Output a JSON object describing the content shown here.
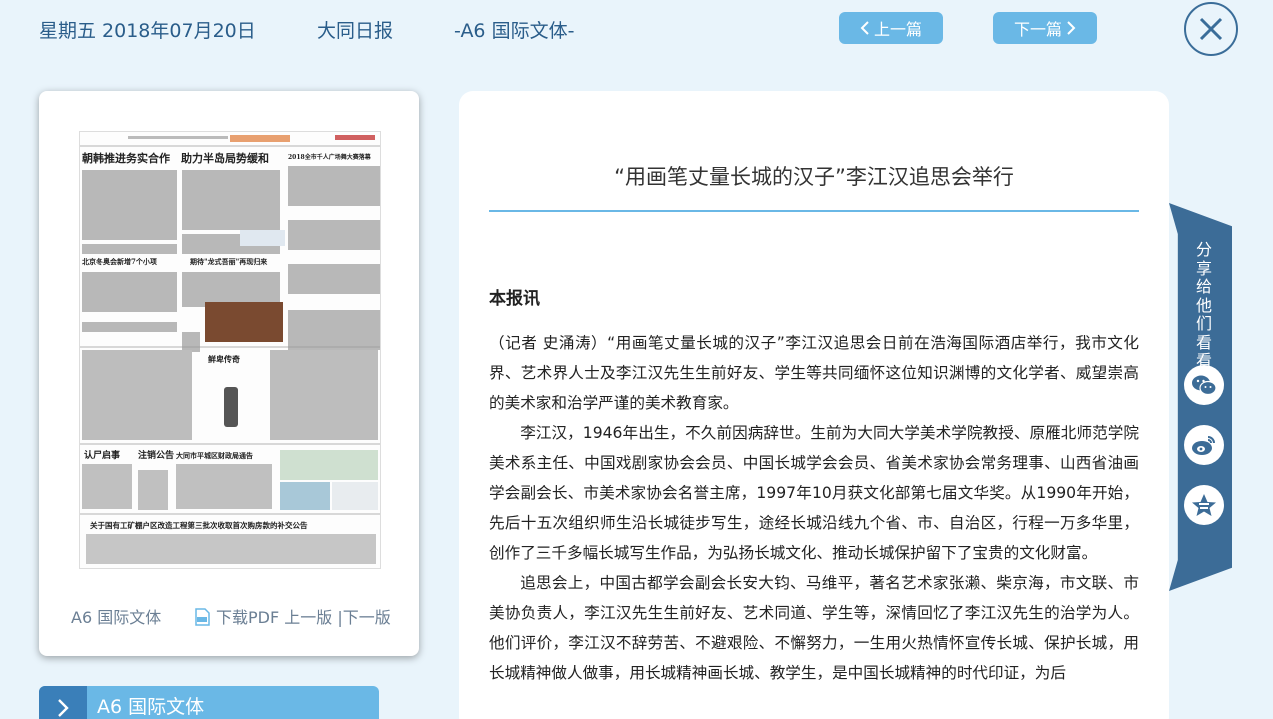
{
  "header": {
    "date": "星期五 2018年07月20日",
    "paper": "大同日报",
    "page": "-A6 国际文体-",
    "prev_label": "上一篇",
    "next_label": "下一篇"
  },
  "left_card": {
    "section": "A6 国际文体",
    "download": "下载PDF",
    "prev_page": "上一版",
    "separator": "|",
    "next_page": "下一版"
  },
  "section_bar": {
    "label": "A6 国际文体"
  },
  "article": {
    "title": "“用画笔丈量长城的汉子”李江汉追思会举行",
    "subtitle": "本报讯",
    "paragraphs": [
      "（记者 史涌涛）“用画笔丈量长城的汉子”李江汉追思会日前在浩海国际酒店举行，我市文化界、艺术界人士及李江汉先生生前好友、学生等共同缅怀这位知识渊博的文化学者、威望崇高的美术家和治学严谨的美术教育家。",
      "李江汉，1946年出生，不久前因病辞世。生前为大同大学美术学院教授、原雁北师范学院美术系主任、中国戏剧家协会会员、中国长城学会会员、省美术家协会常务理事、山西省油画学会副会长、市美术家协会名誉主席，1997年10月获文化部第七届文华奖。从1990年开始，先后十五次组织师生沿长城徒步写生，途经长城沿线九个省、市、自治区，行程一万多华里，创作了三千多幅长城写生作品，为弘扬长城文化、推动长城保护留下了宝贵的文化财富。",
      "追思会上，中国古都学会副会长安大钧、马维平，著名艺术家张濑、柴京海，市文联、市美协负责人，李江汉先生生前好友、艺术同道、学生等，深情回忆了李江汉先生的治学为人。他们评价，李江汉不辞劳苦、不避艰险、不懈努力，一生用火热情怀宣传长城、保护长城，用长城精神做人做事，用长城精神画长城、教学生，是中国长城精神的时代印证，为后"
    ]
  },
  "share": {
    "label": "分享给他们看看"
  },
  "thumbnail": {
    "headline1": "朝韩推进务实合作　助力半岛局势缓和",
    "headline2": "北京冬奥会新增7个小项",
    "headline3": "期待\"龙式吾丽\"再现归来",
    "headline4": "2018全市千人广场舞大赛落幕",
    "headline5": "鲜卑传奇",
    "headline6": "认尸启事",
    "headline7": "注销公告",
    "headline8": "大同市平城区财政局通告",
    "headline9": "关于国有工矿棚户区改造工程第三批次收取首次购房款的补交公告"
  },
  "colors": {
    "accent": "#6ab8e6",
    "dark_blue": "#3c6c97",
    "background": "#e9f4fb"
  }
}
